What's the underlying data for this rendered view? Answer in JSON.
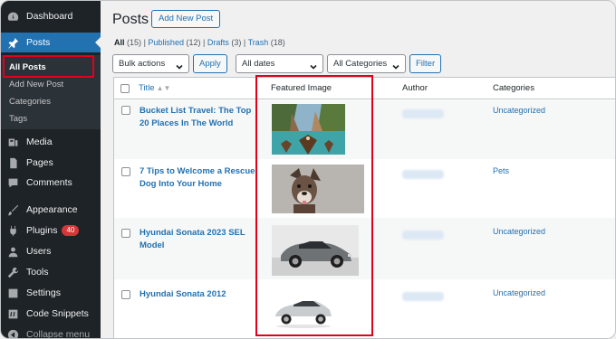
{
  "sidebar": {
    "items": [
      {
        "label": "Dashboard",
        "icon": "dashboard-icon"
      },
      {
        "label": "Posts",
        "icon": "pin-icon"
      },
      {
        "label": "Media",
        "icon": "media-icon"
      },
      {
        "label": "Pages",
        "icon": "pages-icon"
      },
      {
        "label": "Comments",
        "icon": "comments-icon"
      },
      {
        "label": "Appearance",
        "icon": "appearance-icon"
      },
      {
        "label": "Plugins",
        "icon": "plugins-icon",
        "badge": "40"
      },
      {
        "label": "Users",
        "icon": "users-icon"
      },
      {
        "label": "Tools",
        "icon": "tools-icon"
      },
      {
        "label": "Settings",
        "icon": "settings-icon"
      },
      {
        "label": "Code Snippets",
        "icon": "code-snippets-icon"
      }
    ],
    "submenu": [
      "All Posts",
      "Add New Post",
      "Categories",
      "Tags"
    ],
    "collapse": "Collapse menu"
  },
  "header": {
    "title": "Posts",
    "add_new": "Add New Post"
  },
  "filters": {
    "all": "All",
    "all_count": "(15)",
    "published": "Published",
    "published_count": "(12)",
    "drafts": "Drafts",
    "drafts_count": "(3)",
    "trash": "Trash",
    "trash_count": "(18)",
    "sep": "|"
  },
  "toolbar": {
    "bulk_actions": "Bulk actions",
    "apply": "Apply",
    "all_dates": "All dates",
    "all_categories": "All Categories",
    "filter": "Filter"
  },
  "table": {
    "columns": [
      "Title",
      "Featured Image",
      "Author",
      "Categories"
    ],
    "rows": [
      {
        "title": "Bucket List Travel: The Top 20 Places In The World",
        "category": "Uncategorized",
        "image": "canal-boats-photo"
      },
      {
        "title": "7 Tips to Welcome a Rescue Dog Into Your Home",
        "category": "Pets",
        "image": "dog-photo"
      },
      {
        "title": "Hyundai Sonata 2023 SEL Model",
        "category": "Uncategorized",
        "image": "grey-sedan-photo"
      },
      {
        "title": "Hyundai Sonata 2012",
        "category": "Uncategorized",
        "image": "silver-sedan-photo"
      }
    ]
  },
  "colors": {
    "sidebar_bg": "#1d2327",
    "accent": "#2271b1",
    "highlight_red": "#e0001b",
    "badge": "#d63638"
  }
}
